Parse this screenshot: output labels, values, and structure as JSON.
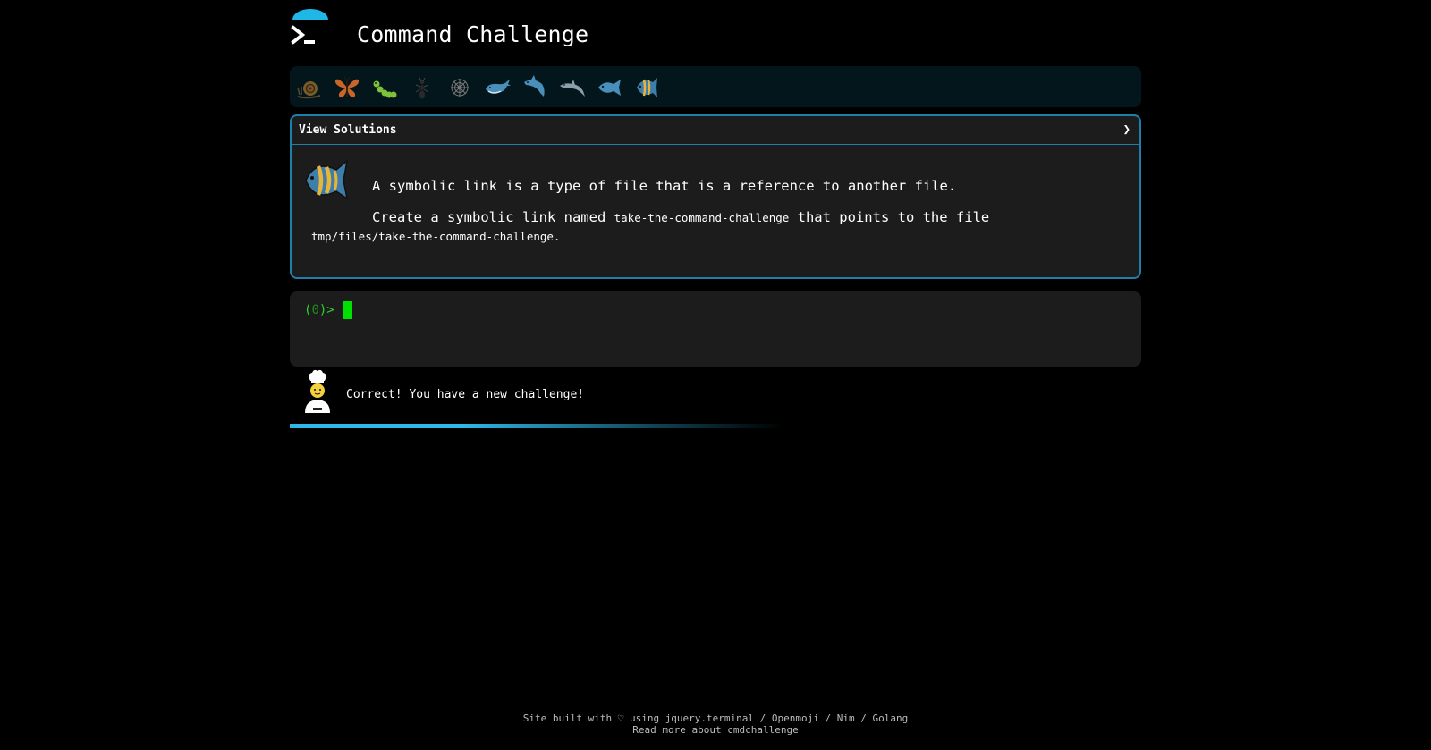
{
  "header": {
    "title": "Command Challenge",
    "logo_icon": "terminal-prompt-icon",
    "accent_color": "#1fb8e6"
  },
  "levels": {
    "icons": [
      "snail-icon",
      "butterfly-icon",
      "caterpillar-icon",
      "ant-icon",
      "spider-web-icon",
      "whale-icon",
      "shark-icon",
      "dolphin-icon",
      "fish-icon",
      "tropical-fish-icon"
    ]
  },
  "solutions": {
    "label": "View Solutions",
    "chevron": "❯"
  },
  "challenge": {
    "icon": "tropical-fish-icon",
    "intro": "A symbolic link is a type of file that is a reference to another file.",
    "task_prefix": "Create a symbolic link named ",
    "task_link_name": "take-the-command-challenge",
    "task_middle": " that points to the file",
    "task_target": "tmp/files/take-the-command-challenge."
  },
  "terminal": {
    "prompt_open": "(",
    "prompt_count": "0",
    "prompt_close": ")>",
    "prompt_color": "#2fd12f"
  },
  "feedback": {
    "icon": "chef-icon",
    "message": "Correct! You have a new challenge!"
  },
  "progress": {
    "fraction": 0.58
  },
  "footer": {
    "line1_prefix": "Site built with ",
    "heart": "♡",
    "line1_using": " using ",
    "link_jquery": "jquery.terminal",
    "sep1": " / ",
    "link_openmoji": "Openmoji",
    "sep2": " / ",
    "link_nim": "Nim",
    "sep3": " / ",
    "link_golang": "Golang",
    "line2": "Read more about cmdchallenge"
  }
}
